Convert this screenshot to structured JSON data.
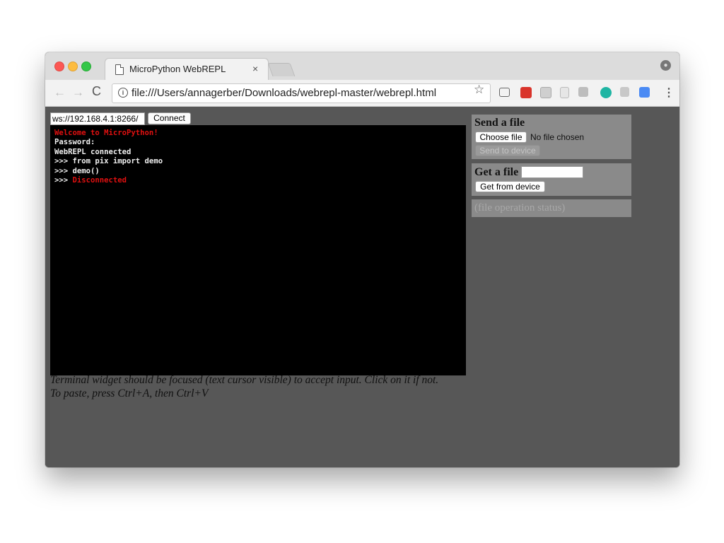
{
  "browser": {
    "tab_title": "MicroPython WebREPL",
    "tab_close": "×",
    "url": "file:///Users/annagerber/Downloads/webrepl-master/webrepl.html",
    "nav": {
      "back": "←",
      "forward": "→",
      "reload": "C"
    },
    "star": "☆",
    "menu": "⋮",
    "profile": "●"
  },
  "connection": {
    "address": "ws://192.168.4.1:8266/",
    "connect_label": "Connect"
  },
  "terminal": {
    "lines": [
      {
        "text": "Welcome to MicroPython!",
        "color": "red"
      },
      {
        "text": "Password:",
        "color": "white"
      },
      {
        "text": "WebREPL connected",
        "color": "white"
      },
      {
        "text": ">>> from pix import demo",
        "color": "white"
      },
      {
        "text": ">>> demo()",
        "color": "white"
      },
      {
        "prompt": ">>> ",
        "text": "Disconnected",
        "color": "red"
      }
    ]
  },
  "help": {
    "line1": "Terminal widget should be focused (text cursor visible) to accept input. Click on it if not.",
    "line2": "To paste, press Ctrl+A, then Ctrl+V"
  },
  "send_file": {
    "heading": "Send a file",
    "choose_label": "Choose file",
    "no_file_text": "No file chosen",
    "send_label": "Send to device"
  },
  "get_file": {
    "heading": "Get a file",
    "filename": "",
    "get_label": "Get from device"
  },
  "status": {
    "text": "(file operation status)"
  },
  "colors": {
    "page_background": "#575757",
    "panel_background": "#8a8a8a",
    "terminal_background": "#000000",
    "terminal_error": "#e01010"
  }
}
